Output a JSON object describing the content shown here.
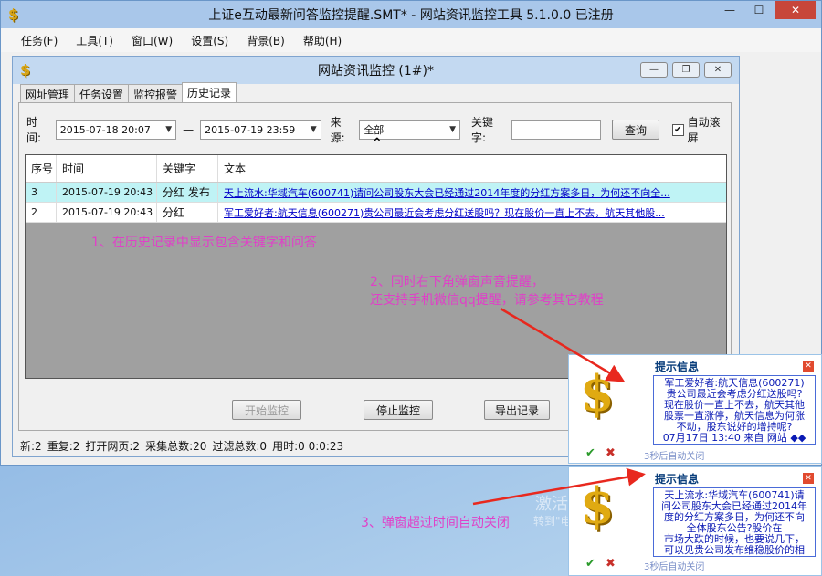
{
  "app": {
    "title": "上证e互动最新问答监控提醒.SMT* - 网站资讯监控工具 5.1.0.0  已注册",
    "menu": [
      "任务(F)",
      "工具(T)",
      "窗口(W)",
      "设置(S)",
      "背景(B)",
      "帮助(H)"
    ]
  },
  "child": {
    "title": "网站资讯监控  (1#)*",
    "tabs": [
      "网址管理",
      "任务设置",
      "监控报警",
      "历史记录"
    ],
    "filter": {
      "time_label": "时间:",
      "time_from": "2015-07-18 20:07",
      "dash": "—",
      "time_to": "2015-07-19 23:59",
      "source_label": "来源:",
      "source_value": "全部",
      "keyword_label": "关键字:",
      "keyword_value": "",
      "query_btn": "查询",
      "autoscroll_label": "自动滚屏",
      "autoscroll_checked": true
    },
    "grid": {
      "headers": [
        "序号",
        "时间",
        "关键字",
        "文本"
      ],
      "rows": [
        {
          "id": "3",
          "time": "2015-07-19 20:43",
          "keyword": "分红 发布",
          "text": "天上流水:华域汽车(600741)请问公司股东大会已经通过2014年度的分红方案多日，为何还不向全..."
        },
        {
          "id": "2",
          "time": "2015-07-19 20:43",
          "keyword": "分红",
          "text": "军工爱好者:航天信息(600271)贵公司最近会考虑分红送股吗？现在股价一直上不去，航天其他股..."
        }
      ]
    },
    "buttons": {
      "start": "开始监控",
      "stop": "停止监控",
      "export": "导出记录"
    },
    "status": [
      "新:2",
      "重复:2",
      "打开网页:2",
      "采集总数:20",
      "过滤总数:0",
      "用时:0 0:0:23"
    ]
  },
  "notes": {
    "n1": "1、在历史记录中显示包含关键字和问答",
    "n2a": "2、同时右下角弹窗声音提醒，",
    "n2b": "还支持手机微信qq提醒，请参考其它教程",
    "n3": "3、弹窗超过时间自动关闭"
  },
  "popups": [
    {
      "title": "提示信息",
      "lines": [
        "军工爱好者:航天信息(600271)",
        "贵公司最近会考虑分红送股吗?",
        "现在股价一直上不去，航天其他",
        "股票一直涨停，航天信息为何涨",
        "不动，股东说好的增持呢?"
      ],
      "date": "07月17日  13:40  来自  网站",
      "footer": "3秒后自动关闭"
    },
    {
      "title": "提示信息",
      "lines": [
        "天上流水:华域汽车(600741)请",
        "问公司股东大会已经通过2014年",
        "度的分红方案多日，为何还不向",
        "全体股东公告?股价在",
        "市场大跌的时候，也要说几下，",
        "可以见贵公司发布维稳股价的相"
      ],
      "footer": "3秒后自动关闭"
    }
  ],
  "watermark": {
    "line1": "激活 Windows",
    "line2": "转到\"电脑设置\"以激活 Windows。"
  },
  "colors": {
    "note": "#e040c8",
    "link": "#0000c8",
    "highlight_row": "#bff3f5",
    "grid_bg": "#a0a0a0"
  }
}
